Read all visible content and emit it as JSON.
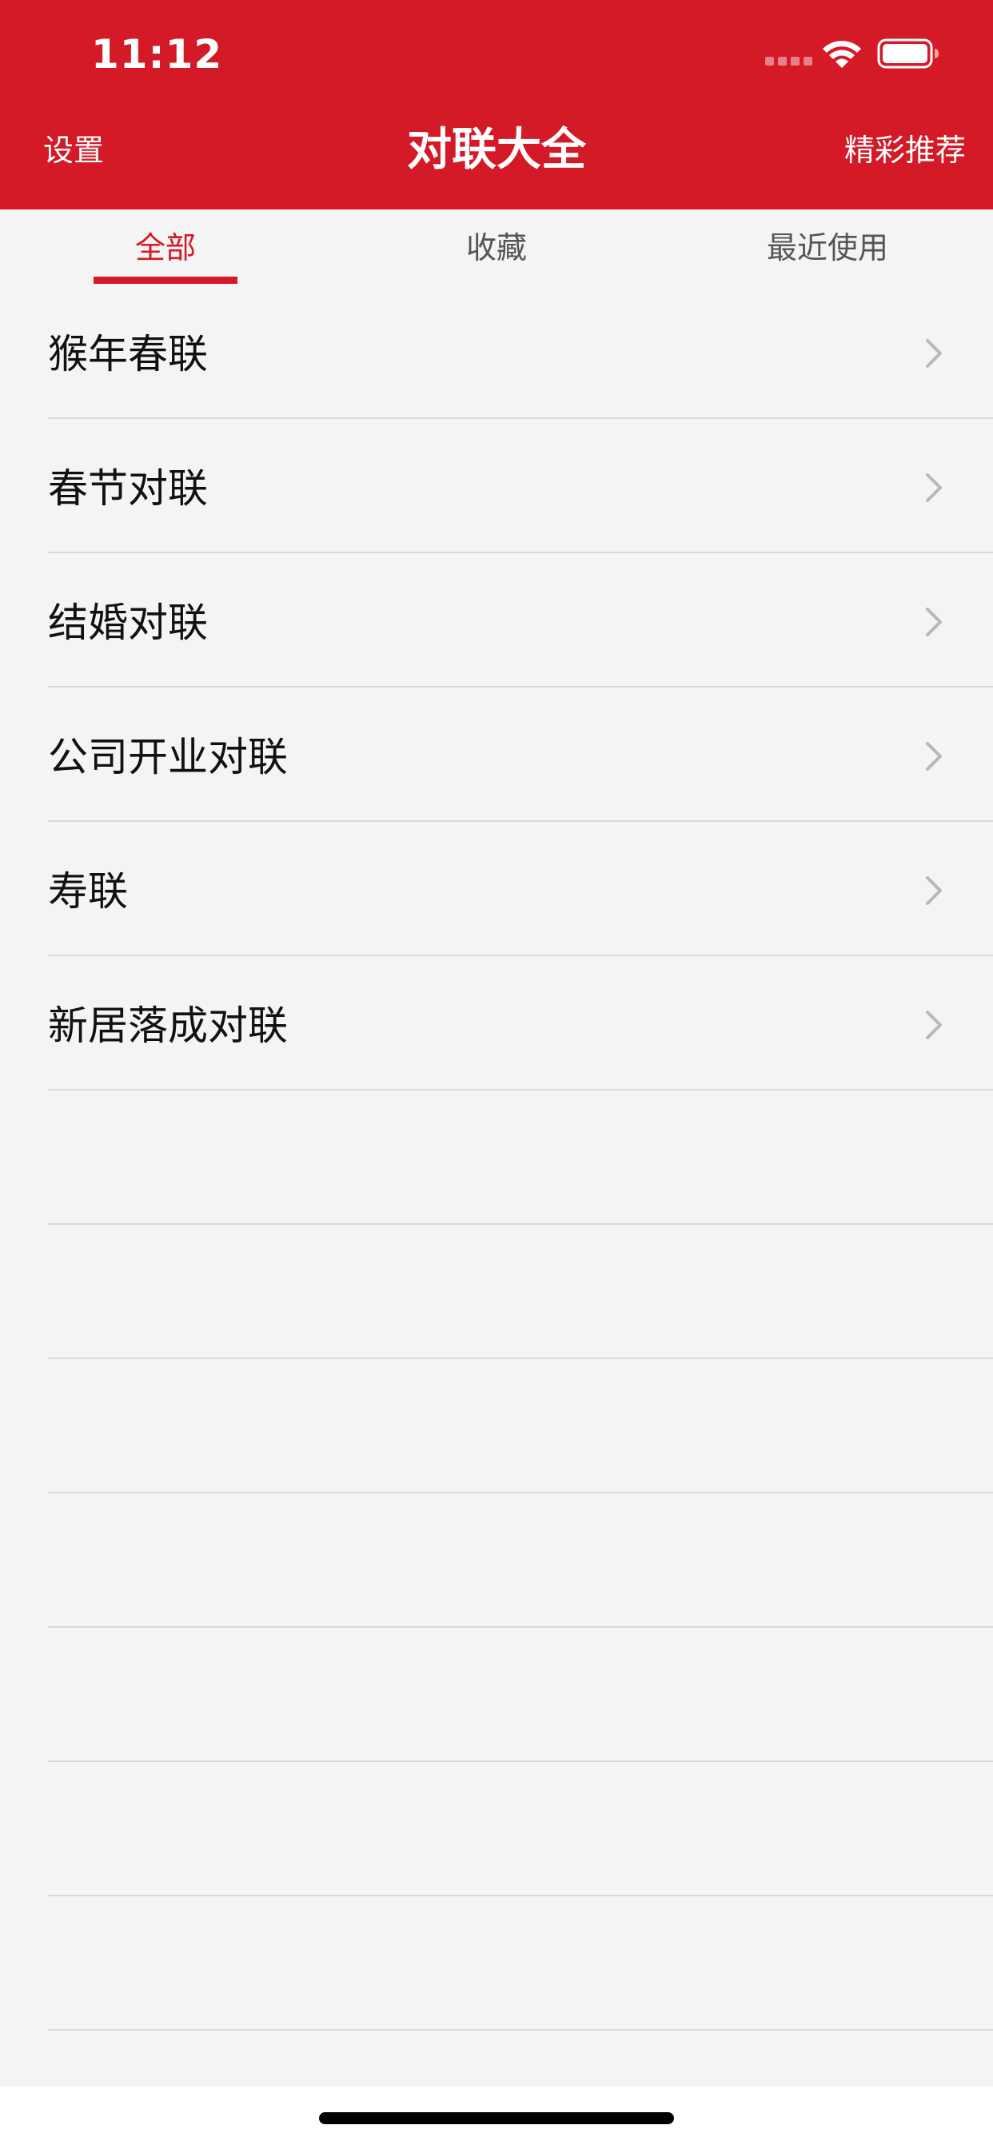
{
  "status_bar": {
    "time": "11:12"
  },
  "nav": {
    "left_label": "设置",
    "title": "对联大全",
    "right_label": "精彩推荐"
  },
  "tabs": [
    {
      "label": "全部",
      "active": true
    },
    {
      "label": "收藏",
      "active": false
    },
    {
      "label": "最近使用",
      "active": false
    }
  ],
  "list": {
    "items": [
      {
        "label": "猴年春联"
      },
      {
        "label": "春节对联"
      },
      {
        "label": "结婚对联"
      },
      {
        "label": "公司开业对联"
      },
      {
        "label": "寿联"
      },
      {
        "label": "新居落成对联"
      }
    ],
    "empty_rows": 7
  },
  "colors": {
    "brand_red": "#d41927",
    "background": "#f4f4f4",
    "divider": "#d9d9d9",
    "chevron": "#b8b8b8"
  },
  "icons": {
    "wifi": "wifi-icon",
    "battery": "battery-icon",
    "chevron": "chevron-right-icon"
  }
}
